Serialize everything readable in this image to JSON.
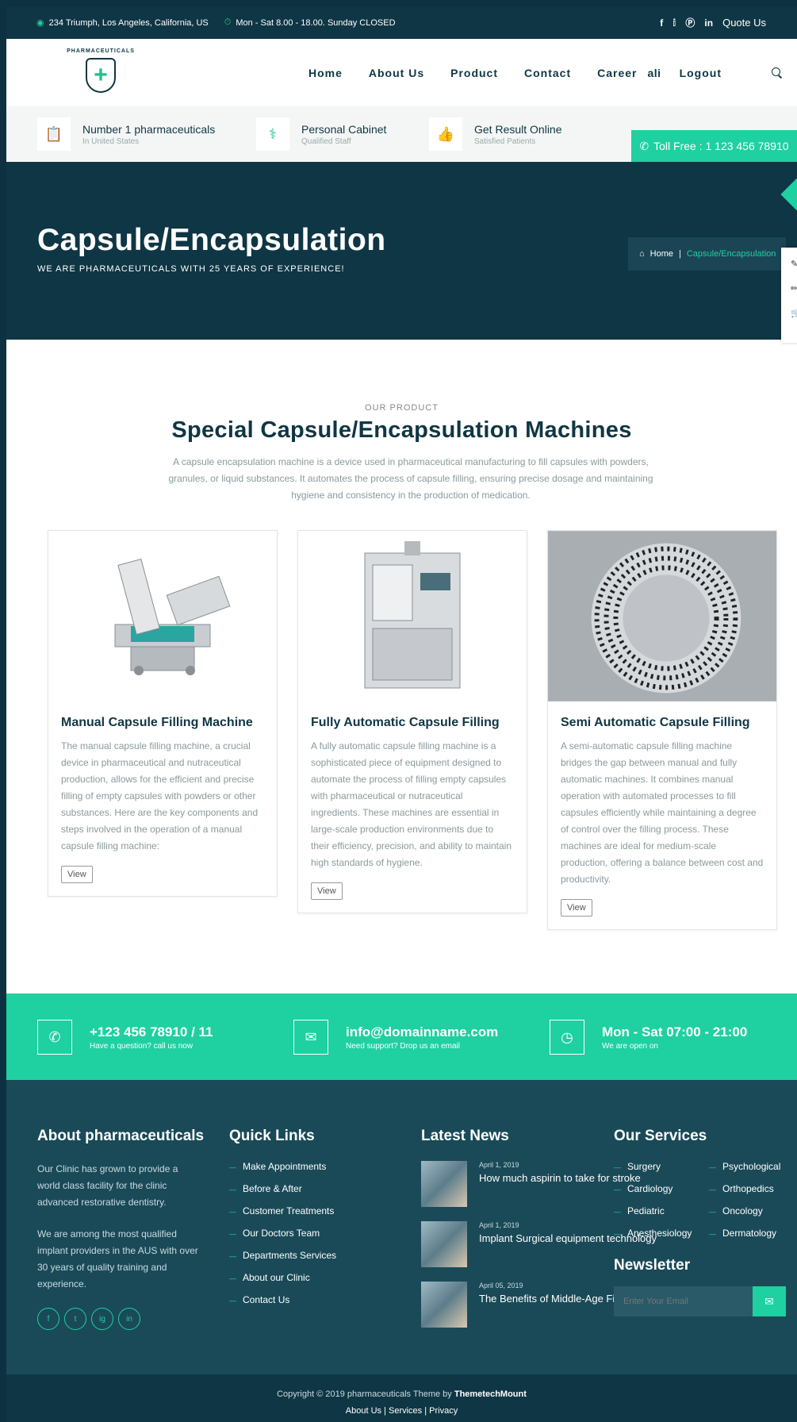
{
  "topbar": {
    "address": "234 Triumph, Los Angeles, California, US",
    "hours": "Mon - Sat 8.00 - 18.00. Sunday CLOSED",
    "social": [
      "f",
      "t",
      "p",
      "in"
    ],
    "quote": "Quote Us"
  },
  "nav": {
    "logo_text": "PHARMACEUTICALS",
    "items": [
      "Home",
      "About Us",
      "Product",
      "Contact",
      "Career"
    ],
    "user": "ali",
    "logout": "Logout"
  },
  "features": [
    {
      "title": "Number 1 pharmaceuticals",
      "sub": "In United States",
      "icon": "clipboard-icon"
    },
    {
      "title": "Personal Cabinet",
      "sub": "Qualified Staff",
      "icon": "doctor-icon"
    },
    {
      "title": "Get Result Online",
      "sub": "Satisfied Patients",
      "icon": "thumbs-up-icon"
    }
  ],
  "tollfree": "Toll Free : 1 123 456 78910",
  "hero": {
    "title": "Capsule/Encapsulation",
    "tagline": "WE ARE PHARMACEUTICALS WITH 25 YEARS OF EXPERIENCE!",
    "breadcrumb_home": "Home",
    "breadcrumb_sep": "|",
    "breadcrumb_current": "Capsule/Encapsulation"
  },
  "section": {
    "eyebrow": "OUR PRODUCT",
    "title": "Special Capsule/Encapsulation Machines",
    "desc": "A capsule encapsulation machine is a device used in pharmaceutical manufacturing to fill capsules with powders, granules, or liquid substances. It automates the process of capsule filling, ensuring precise dosage and maintaining hygiene and consistency in the production of medication."
  },
  "cards": [
    {
      "title": "Manual Capsule Filling Machine",
      "text": "The manual capsule filling machine, a crucial device in pharmaceutical and nutraceutical production, allows for the efficient and precise filling of empty capsules with powders or other substances. Here are the key components and steps involved in the operation of a manual capsule filling machine:",
      "button": "View"
    },
    {
      "title": "Fully Automatic Capsule Filling",
      "text": "A fully automatic capsule filling machine is a sophisticated piece of equipment designed to automate the process of filling empty capsules with pharmaceutical or nutraceutical ingredients. These machines are essential in large-scale production environments due to their efficiency, precision, and ability to maintain high standards of hygiene.",
      "button": "View"
    },
    {
      "title": "Semi Automatic Capsule Filling",
      "text": "A semi-automatic capsule filling machine bridges the gap between manual and fully automatic machines. It combines manual operation with automated processes to fill capsules efficiently while maintaining a degree of control over the filling process. These machines are ideal for medium-scale production, offering a balance between cost and productivity.",
      "button": "View"
    }
  ],
  "contact": [
    {
      "big": "+123 456 78910 / 11",
      "small": "Have a question? call us now",
      "icon": "phone-icon"
    },
    {
      "big": "info@domainname.com",
      "small": "Need support? Drop us an email",
      "icon": "mail-icon"
    },
    {
      "big": "Mon - Sat 07:00 - 21:00",
      "small": "We are open on",
      "icon": "clock-icon"
    }
  ],
  "footer": {
    "about_title": "About pharmaceuticals",
    "about_p1": "Our Clinic has grown to provide a world class facility for the clinic advanced restorative dentistry.",
    "about_p2": "We are among the most qualified implant providers in the AUS with over 30 years of quality training and experience.",
    "social": [
      "f",
      "t",
      "ig",
      "in"
    ],
    "links_title": "Quick Links",
    "links": [
      "Make Appointments",
      "Before & After",
      "Customer Treatments",
      "Our Doctors Team",
      "Departments Services",
      "About our Clinic",
      "Contact Us"
    ],
    "news_title": "Latest News",
    "news": [
      {
        "date": "April 1, 2019",
        "title": "How much aspirin to take for stroke"
      },
      {
        "date": "April 1, 2019",
        "title": "Implant Surgical equipment technology"
      },
      {
        "date": "April 05, 2019",
        "title": "The Benefits of Middle-Age Fitness"
      }
    ],
    "services_title": "Our Services",
    "services": [
      "Surgery",
      "Psychological",
      "Cardiology",
      "Orthopedics",
      "Pediatric",
      "Oncology",
      "Anesthesiology",
      "Dermatology"
    ],
    "newsletter_title": "Newsletter",
    "newsletter_placeholder": "Enter Your Email"
  },
  "copyright": {
    "text": "Copyright © 2019 pharmaceuticals Theme by",
    "brand": "ThemetechMount",
    "links": [
      "About Us",
      "Services",
      "Privacy"
    ]
  },
  "colors": {
    "primary": "#0f3644",
    "accent": "#1fd0a0",
    "footer": "#1a4a58"
  }
}
